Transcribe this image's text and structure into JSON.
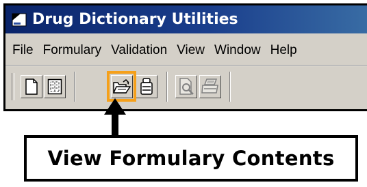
{
  "window": {
    "title": "Drug Dictionary Utilities"
  },
  "menubar": {
    "items": [
      "File",
      "Formulary",
      "Validation",
      "View",
      "Window",
      "Help"
    ]
  },
  "toolbar": {
    "buttons": [
      {
        "icon": "new-document-icon",
        "enabled": true
      },
      {
        "icon": "grid-document-icon",
        "enabled": true
      },
      {
        "icon": "open-folder-icon",
        "enabled": true,
        "highlighted": true
      },
      {
        "icon": "phone-icon",
        "enabled": true
      },
      {
        "icon": "print-preview-icon",
        "enabled": false
      },
      {
        "icon": "printer-icon",
        "enabled": false
      }
    ]
  },
  "callout": {
    "text": "View Formulary Contents"
  },
  "colors": {
    "titlebar_start": "#0a246a",
    "titlebar_end": "#3a6ea5",
    "highlight": "#f5a01a",
    "window_face": "#d4d0c8"
  }
}
